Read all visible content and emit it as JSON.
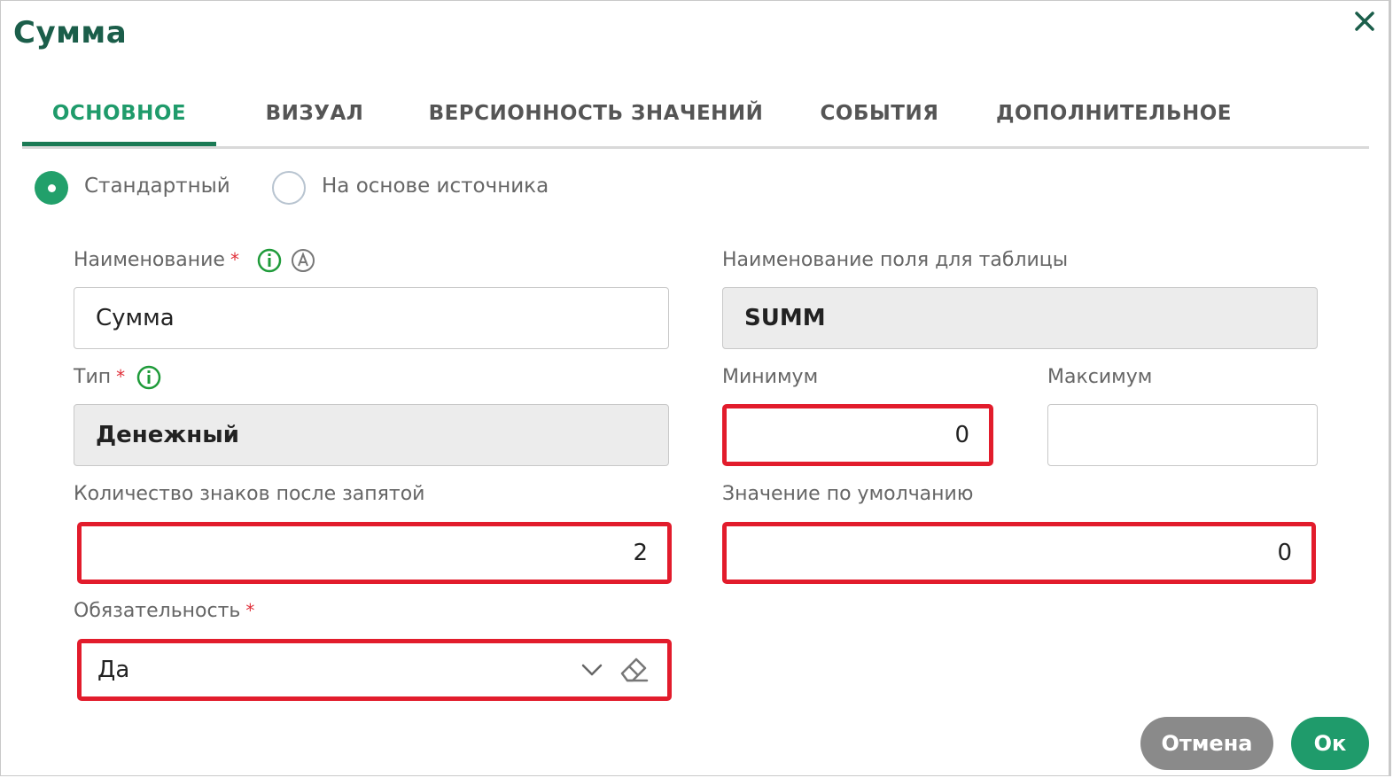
{
  "dialog": {
    "title": "Сумма"
  },
  "tabs": [
    {
      "label": "ОСНОВНОЕ",
      "active": true
    },
    {
      "label": "ВИЗУАЛ",
      "active": false
    },
    {
      "label": "ВЕРСИОННОСТЬ ЗНАЧЕНИЙ",
      "active": false
    },
    {
      "label": "СОБЫТИЯ",
      "active": false
    },
    {
      "label": "ДОПОЛНИТЕЛЬНОЕ",
      "active": false
    }
  ],
  "source_mode": {
    "options": [
      {
        "label": "Стандартный",
        "selected": true
      },
      {
        "label": "На основе источника",
        "selected": false
      }
    ]
  },
  "fields": {
    "name": {
      "label": "Наименование",
      "required_mark": "*",
      "value": "Сумма"
    },
    "table_field_name": {
      "label": "Наименование поля для таблицы",
      "value": "SUMM"
    },
    "type": {
      "label": "Тип",
      "required_mark": "*",
      "value": "Денежный"
    },
    "minimum": {
      "label": "Минимум",
      "value": "0"
    },
    "maximum": {
      "label": "Максимум",
      "value": ""
    },
    "decimals": {
      "label": "Количество знаков после запятой",
      "value": "2"
    },
    "default_value": {
      "label": "Значение по умолчанию",
      "value": "0"
    },
    "required": {
      "label": "Обязательность",
      "required_mark": "*",
      "value": "Да"
    }
  },
  "buttons": {
    "cancel": "Отмена",
    "ok": "Ок"
  },
  "colors": {
    "accent": "#1f9b6b",
    "title": "#1b5e4a",
    "highlight": "#e21c2c",
    "required": "#e0303a",
    "cancel_button": "#8a8a8a"
  },
  "icons": [
    "close-icon",
    "info-icon",
    "autofill-icon",
    "chevron-down-icon",
    "eraser-icon"
  ]
}
